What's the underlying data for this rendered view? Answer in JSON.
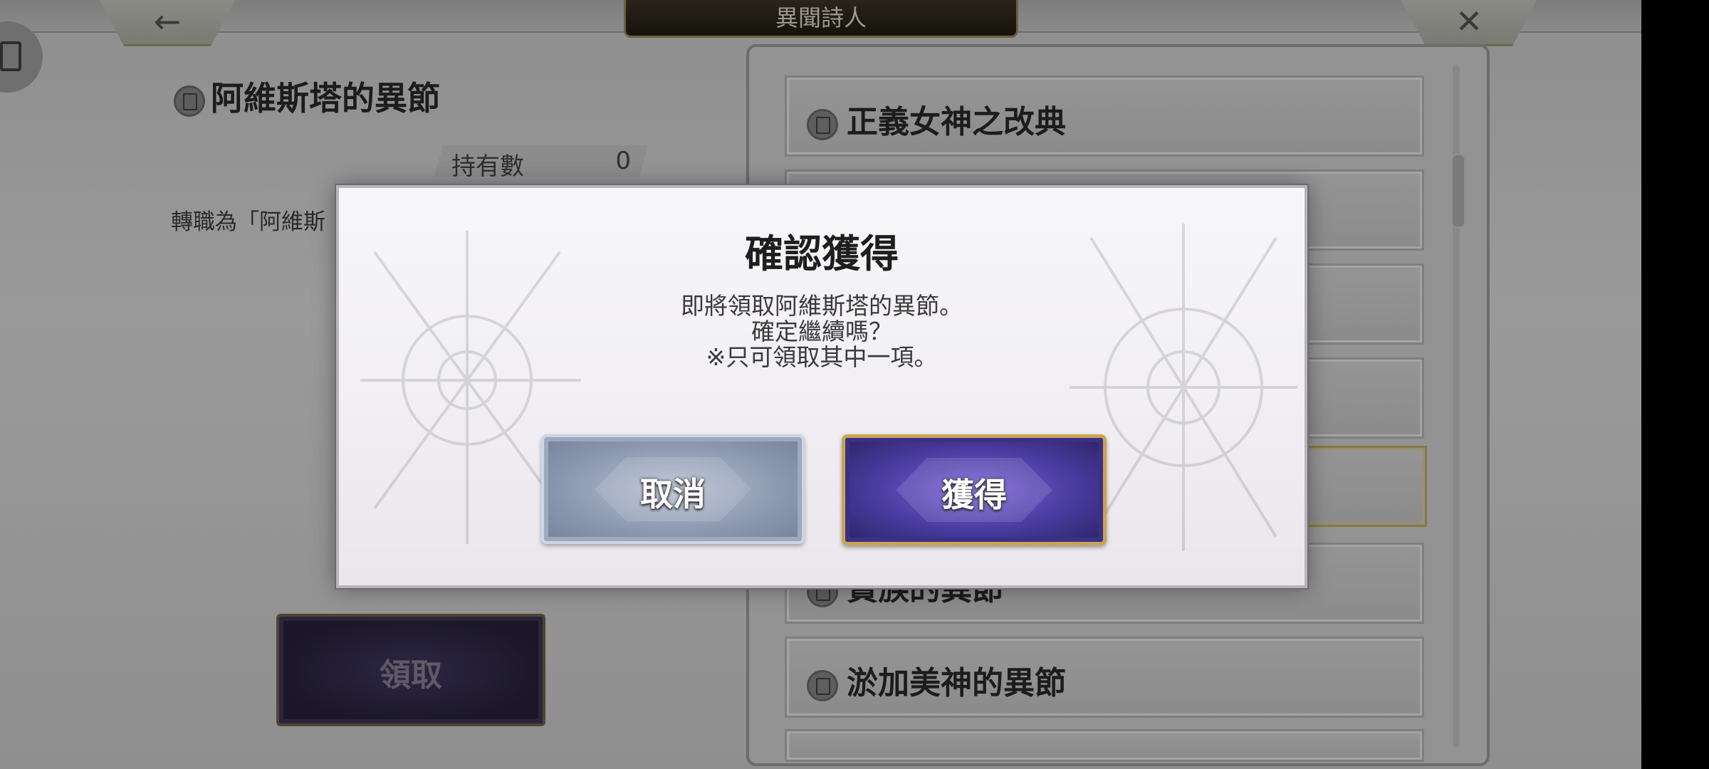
{
  "header": {
    "title": "異聞詩人",
    "back_icon": "←",
    "close_icon": "✕"
  },
  "left_panel": {
    "title": "阿維斯塔的異節",
    "owned_label": "持有數",
    "owned_value": "0",
    "description": "轉職為「阿維斯",
    "claim_label": "領取"
  },
  "list": {
    "items": [
      {
        "name": "正義女神之改典"
      },
      {
        "name": ""
      },
      {
        "name": ""
      },
      {
        "name": ""
      },
      {
        "name": ""
      },
      {
        "name": "貴族的異節"
      },
      {
        "name": "淤加美神的異節"
      },
      {
        "name": ""
      }
    ]
  },
  "dialog": {
    "title": "確認獲得",
    "message_line1": "即將領取阿維斯塔的異節。",
    "message_line2": "確定繼續嗎？",
    "message_line3": "※只可領取其中一項。",
    "cancel_label": "取消",
    "confirm_label": "獲得"
  },
  "colors": {
    "confirm_border": "#c9a552",
    "confirm_fill": "#4a3ba0",
    "cancel_fill": "#8c98b0"
  }
}
